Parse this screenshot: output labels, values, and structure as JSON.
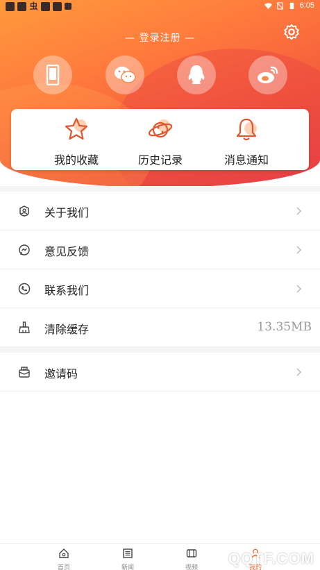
{
  "status_bar": {
    "time": "6:05"
  },
  "header": {
    "login_text": "— 登录注册 —"
  },
  "socials": [
    {
      "name": "phone-login",
      "icon": "phone-icon"
    },
    {
      "name": "wechat-login",
      "icon": "wechat-icon"
    },
    {
      "name": "qq-login",
      "icon": "qq-icon"
    },
    {
      "name": "weibo-login",
      "icon": "weibo-icon"
    }
  ],
  "quick_actions": [
    {
      "label": "我的收藏",
      "icon": "star-icon"
    },
    {
      "label": "历史记录",
      "icon": "planet-icon"
    },
    {
      "label": "消息通知",
      "icon": "bell-icon"
    }
  ],
  "menu": [
    {
      "label": "关于我们",
      "icon": "about-icon"
    },
    {
      "label": "意见反馈",
      "icon": "feedback-icon"
    },
    {
      "label": "联系我们",
      "icon": "phone-call-icon"
    },
    {
      "label": "清除缓存",
      "icon": "broom-icon",
      "value": "13.35MB"
    }
  ],
  "menu2": [
    {
      "label": "邀请码",
      "icon": "invite-icon"
    }
  ],
  "tabs": [
    {
      "label": "首页",
      "icon": "home-icon"
    },
    {
      "label": "新闻",
      "icon": "news-icon"
    },
    {
      "label": "视频",
      "icon": "video-icon"
    },
    {
      "label": "我的",
      "icon": "profile-icon"
    }
  ],
  "watermark": "QQTF.COM",
  "colors": {
    "accent": "#f26b3a",
    "header_start": "#ff9a3c",
    "header_end": "#e8404a"
  }
}
